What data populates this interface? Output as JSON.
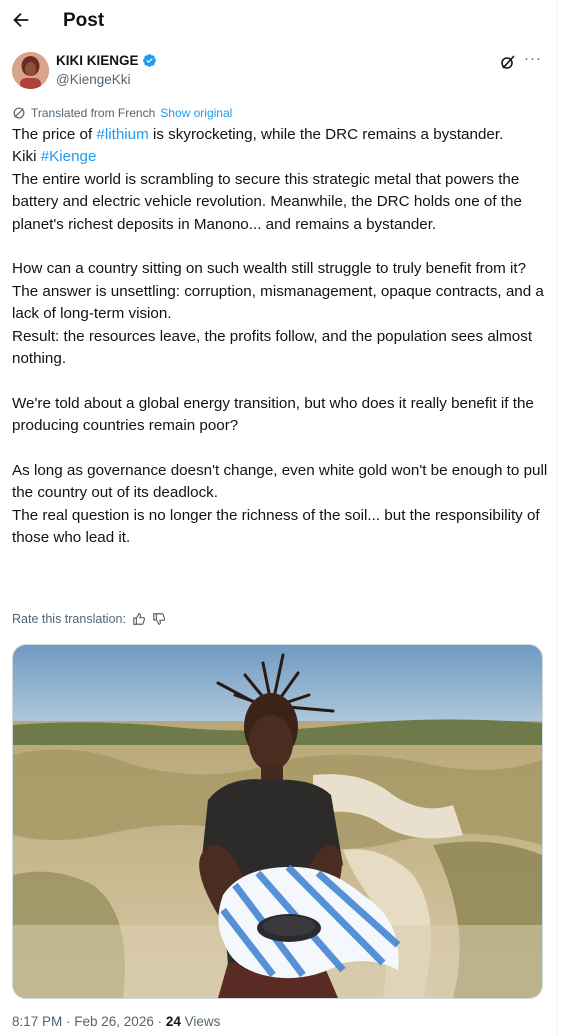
{
  "header": {
    "title": "Post",
    "back_icon": "arrow-left-icon"
  },
  "author": {
    "name": "KIKI KIENGE",
    "handle": "@KiengeKki",
    "verified_icon": "verified-badge-icon",
    "verified_color": "#1d9bf0"
  },
  "actions": {
    "grok_icon": "grok-icon",
    "more_icon": "more-dots-icon"
  },
  "translation": {
    "label": "Translated from French",
    "show_original": "Show original",
    "icon": "translate-icon"
  },
  "post": {
    "l1_pre": "The price of ",
    "l1_tag": "#lithium",
    "l1_post": " is skyrocketing, while the DRC remains a bystander.",
    "l2_pre": "Kiki ",
    "l2_tag": "#Kienge",
    "p1": "The entire world is scrambling to secure this strategic metal that powers the battery and electric vehicle revolution. Meanwhile, the DRC holds one of the planet's richest deposits in Manono... and remains a bystander.",
    "p2": "How can a country sitting on such wealth still struggle to truly benefit from it?",
    "p3": "The answer is unsettling: corruption, mismanagement, opaque contracts, and a lack of long-term vision.",
    "p4": "Result: the resources leave, the profits follow, and the population sees almost nothing.",
    "p5": "We're told about a global energy transition, but who does it really benefit if the producing countries remain poor?",
    "p6": "As long as governance doesn't change, even white gold won't be enough to pull the country out of its deadlock.",
    "p7": "The real question is no longer the richness of the soil... but the responsibility of those who lead it."
  },
  "rate": {
    "label": "Rate this translation:",
    "up_icon": "thumbs-up-icon",
    "down_icon": "thumbs-down-icon"
  },
  "meta": {
    "time": "8:17 PM · Feb 26, 2026 · ",
    "views_count": "24",
    "views_label": " Views"
  },
  "colors": {
    "link": "#1d9bf0",
    "muted": "#536471",
    "text": "#0f1419"
  }
}
